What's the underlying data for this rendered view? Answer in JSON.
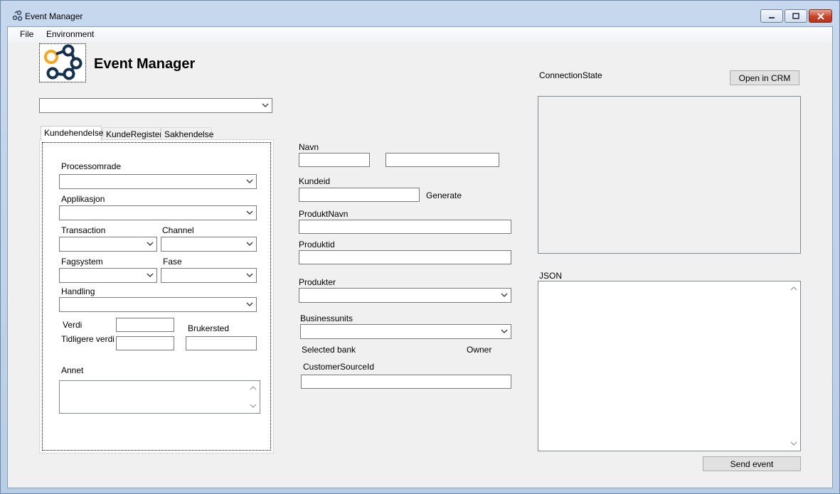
{
  "window": {
    "title": "Event Manager"
  },
  "menu": {
    "file": "File",
    "environment": "Environment"
  },
  "header": {
    "app_title": "Event Manager",
    "logo_icon": "chain-links-icon",
    "accent_color": "#f5a623",
    "logo_color": "#14324f"
  },
  "environment_select": {
    "value": ""
  },
  "tabs": [
    {
      "label": "Kundehendelse",
      "active": true
    },
    {
      "label": "KundeRegister",
      "active": false
    },
    {
      "label": "Sakhendelse",
      "active": false
    }
  ],
  "kundehendelse": {
    "processomrade_label": "Processomrade",
    "applikasjon_label": "Applikasjon",
    "transaction_label": "Transaction",
    "channel_label": "Channel",
    "fagsystem_label": "Fagsystem",
    "fase_label": "Fase",
    "handling_label": "Handling",
    "verdi_label": "Verdi",
    "tidligere_verdi_label": "Tidligere verdi",
    "brukersted_label": "Brukersted",
    "annet_label": "Annet"
  },
  "middle": {
    "navn_label": "Navn",
    "kundeid_label": "Kundeid",
    "generate_label": "Generate",
    "produktnavn_label": "ProduktNavn",
    "produktid_label": "Produktid",
    "produkter_label": "Produkter",
    "businessunits_label": "Businessunits",
    "selected_bank_label": "Selected bank",
    "owner_label": "Owner",
    "customer_source_id_label": "CustomerSourceId"
  },
  "right": {
    "connection_state_label": "ConnectionState",
    "open_in_crm_button": "Open in CRM",
    "json_label": "JSON",
    "send_event_button": "Send event"
  },
  "colors": {
    "close_button": "#c7432a",
    "form_background": "#f0f0f0"
  }
}
